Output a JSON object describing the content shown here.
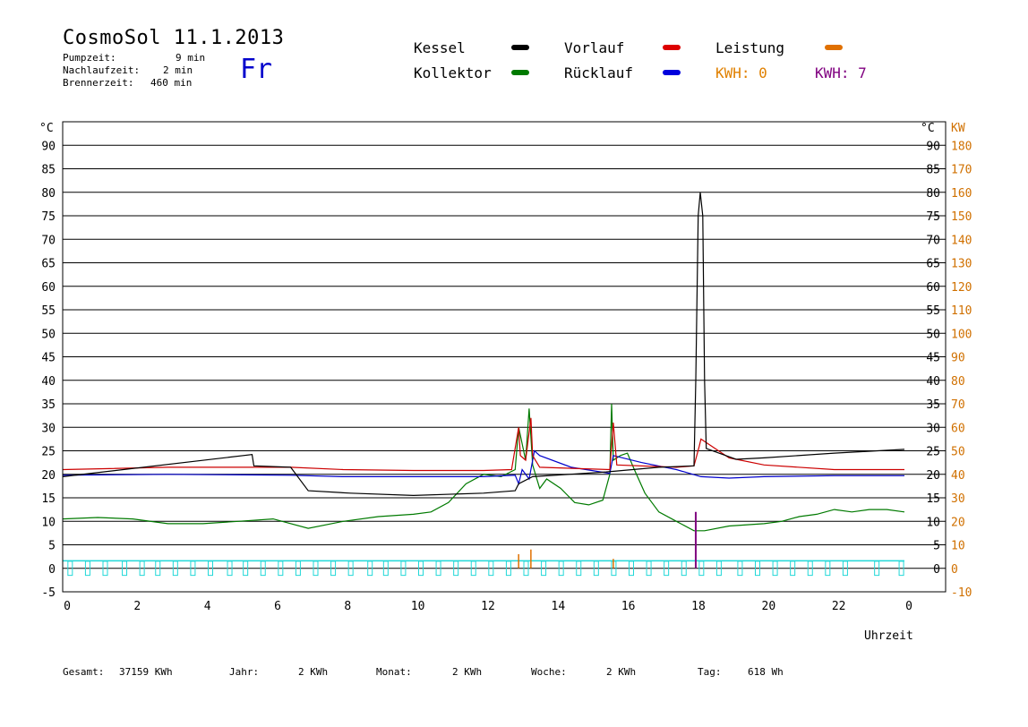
{
  "header": {
    "title": "CosmoSol 11.1.2013",
    "day": "Fr",
    "pump_label": "Pumpzeit:",
    "pump_value": "9 min",
    "after_label": "Nachlaufzeit:",
    "after_value": "2 min",
    "burner_label": "Brennerzeit:",
    "burner_value": "460 min"
  },
  "legend": {
    "kessel": "Kessel",
    "kollektor": "Kollektor",
    "vorlauf": "Vorlauf",
    "ruecklauf": "Rücklauf",
    "leistung": "Leistung",
    "kwh_a": "KWH: 0",
    "kwh_b": "KWH: 7"
  },
  "colors": {
    "kessel": "#000000",
    "kollektor": "#007a00",
    "vorlauf": "#cc0000",
    "ruecklauf": "#0000cc",
    "leistung": "#e07000",
    "kwh_b": "#800080",
    "cyan": "#22d8d8",
    "kw_axis": "#d07000"
  },
  "footer": {
    "gesamt_label": "Gesamt:",
    "gesamt_value": "37159 KWh",
    "jahr_label": "Jahr:",
    "jahr_value": "2 KWh",
    "monat_label": "Monat:",
    "monat_value": "2 KWh",
    "woche_label": "Woche:",
    "woche_value": "2 KWh",
    "tag_label": "Tag:",
    "tag_value": "618 Wh"
  },
  "chart_data": {
    "type": "line",
    "xlabel": "Uhrzeit",
    "ylabel_left": "°C",
    "ylabel_right_c": "°C",
    "ylabel_right_kw": "KW",
    "xlim": [
      0,
      24
    ],
    "ylim": [
      -5,
      95
    ],
    "grid": true,
    "x_ticks": [
      "0",
      "2",
      "4",
      "6",
      "8",
      "10",
      "12",
      "14",
      "16",
      "18",
      "20",
      "22",
      "0"
    ],
    "x_tick_values": [
      0,
      2,
      4,
      6,
      8,
      10,
      12,
      14,
      16,
      18,
      20,
      22,
      24
    ],
    "y_ticks_left": [
      "-5",
      "0",
      "5",
      "10",
      "15",
      "20",
      "25",
      "30",
      "35",
      "40",
      "45",
      "50",
      "55",
      "60",
      "65",
      "70",
      "75",
      "80",
      "85",
      "90"
    ],
    "y_ticks_right_c": [
      "0",
      "5",
      "10",
      "15",
      "20",
      "25",
      "30",
      "35",
      "40",
      "45",
      "50",
      "55",
      "60",
      "65",
      "70",
      "75",
      "80",
      "85",
      "90"
    ],
    "y_ticks_right_kw": [
      "-10",
      "0",
      "10",
      "20",
      "30",
      "40",
      "50",
      "60",
      "70",
      "80",
      "90",
      "100",
      "110",
      "120",
      "130",
      "140",
      "150",
      "160",
      "170",
      "180"
    ],
    "series": [
      {
        "name": "Kessel",
        "key": "kessel",
        "x": [
          0,
          5.4,
          5.45,
          6.5,
          7.0,
          8.2,
          10,
          12,
          12.9,
          13.0,
          13.4,
          15.5,
          17.0,
          18.0,
          18.05,
          18.12,
          18.18,
          18.25,
          18.3,
          18.35,
          19.2,
          20,
          22,
          24
        ],
        "y": [
          19.5,
          24.2,
          21.8,
          21.5,
          16.5,
          16.0,
          15.5,
          16.0,
          16.5,
          18,
          19.5,
          20.5,
          21.5,
          21.8,
          40,
          75,
          80,
          75,
          40,
          25.5,
          23.2,
          23.5,
          24.5,
          25.3
        ]
      },
      {
        "name": "Vorlauf",
        "key": "vorlauf",
        "x": [
          0,
          3,
          6.5,
          8,
          10,
          12,
          12.8,
          13.0,
          13.05,
          13.2,
          13.35,
          13.4,
          13.6,
          15.6,
          15.7,
          15.8,
          17.5,
          18.0,
          18.15,
          18.2,
          19.0,
          20.0,
          22,
          24
        ],
        "y": [
          21,
          21.5,
          21.5,
          21,
          20.8,
          20.8,
          21,
          30,
          24,
          23,
          32,
          24,
          21.5,
          21,
          31,
          22,
          21.5,
          21.8,
          26,
          27.5,
          23.5,
          22,
          21,
          21
        ]
      },
      {
        "name": "Rücklauf",
        "key": "ruecklauf",
        "x": [
          0,
          3,
          6.5,
          8,
          10,
          12,
          12.9,
          13.0,
          13.1,
          13.3,
          13.45,
          13.6,
          14.5,
          15.6,
          15.7,
          16.5,
          17.5,
          18.2,
          19,
          20,
          22,
          24
        ],
        "y": [
          19.8,
          20,
          19.8,
          19.5,
          19.5,
          19.5,
          19.8,
          18,
          21,
          19,
          25,
          24,
          21.5,
          20.2,
          24,
          22.5,
          21,
          19.5,
          19.2,
          19.5,
          19.7,
          19.7
        ]
      },
      {
        "name": "Kollektor",
        "key": "kollektor",
        "x": [
          0,
          1,
          2,
          3,
          4,
          5,
          6,
          7,
          8,
          9,
          10,
          10.5,
          11,
          11.5,
          12,
          12.5,
          12.9,
          13.0,
          13.2,
          13.3,
          13.4,
          13.6,
          13.8,
          14.2,
          14.6,
          15.0,
          15.4,
          15.6,
          15.65,
          15.7,
          15.9,
          16.1,
          16.3,
          16.6,
          17.0,
          17.5,
          18.0,
          18.3,
          19,
          20,
          20.5,
          21,
          21.5,
          22,
          22.5,
          23,
          23.5,
          24
        ],
        "y": [
          10.5,
          10.8,
          10.5,
          9.5,
          9.5,
          10,
          10.5,
          8.5,
          10,
          11,
          11.5,
          12,
          14,
          18,
          20,
          19.5,
          21,
          30,
          23,
          34,
          22,
          17,
          19,
          17,
          14,
          13.5,
          14.5,
          20,
          35,
          23,
          24,
          24.5,
          21,
          16,
          12,
          10,
          8,
          8,
          9,
          9.5,
          10,
          11,
          11.5,
          12.5,
          12,
          12.5,
          12.5,
          12
        ]
      }
    ],
    "leistung_spikes": {
      "x": [
        13.0,
        13.35,
        15.7
      ],
      "kw": [
        6,
        8,
        4
      ]
    },
    "kwh_marker": {
      "x": 18.05,
      "kw": 24
    },
    "cyan_square_x": [
      0.2,
      0.7,
      1.2,
      1.75,
      2.25,
      2.7,
      3.2,
      3.7,
      4.2,
      4.75,
      5.2,
      5.7,
      6.2,
      6.7,
      7.2,
      7.7,
      8.2,
      8.75,
      9.2,
      9.7,
      10.2,
      10.7,
      11.2,
      11.7,
      12.2,
      12.7,
      13.2,
      13.7,
      14.2,
      14.7,
      15.2,
      15.7,
      16.2,
      16.7,
      17.2,
      17.7,
      18.2,
      18.7,
      19.3,
      19.8,
      20.3,
      20.8,
      21.3,
      21.8,
      22.3,
      23.2,
      23.9
    ]
  }
}
